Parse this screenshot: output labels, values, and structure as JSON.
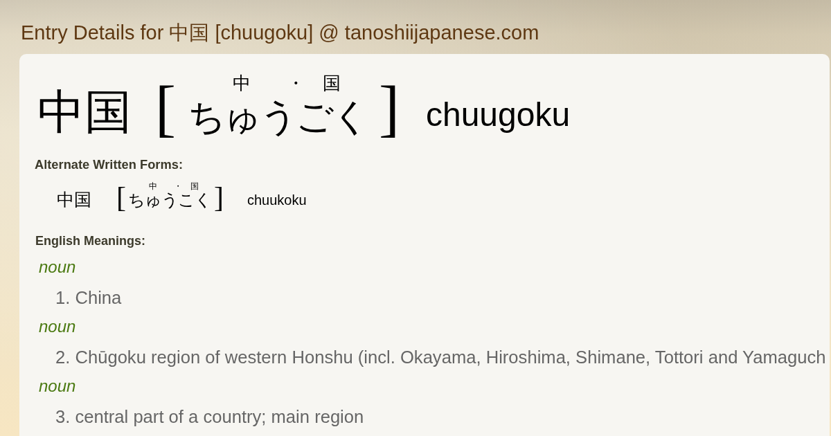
{
  "page_title": "Entry Details for 中国 [chuugoku] @ tanoshiijapanese.com",
  "entry": {
    "word": "中国",
    "reading": {
      "open": "[",
      "segments": [
        {
          "kanji": "中",
          "kana": "ちゅう"
        },
        {
          "kanji": "国",
          "kana": "ごく"
        }
      ],
      "separator": "・",
      "close": "]"
    },
    "romaji": "chuugoku"
  },
  "alternate_forms": {
    "heading": "Alternate Written Forms:",
    "forms": [
      {
        "word": "中国",
        "reading": {
          "open": "[",
          "segments": [
            {
              "kanji": "中",
              "kana": "ちゅう"
            },
            {
              "kanji": "国",
              "kana": "こく"
            }
          ],
          "separator": "・",
          "close": "]"
        },
        "romaji": "chuukoku"
      }
    ]
  },
  "meanings": {
    "heading": "English Meanings:",
    "senses": [
      {
        "pos": "noun",
        "text": "1. China"
      },
      {
        "pos": "noun",
        "text": "2. Chūgoku region of western Honshu (incl. Okayama, Hiroshima, Shimane, Tottori and Yamaguch"
      },
      {
        "pos": "noun",
        "text": "3. central part of a country; main region"
      }
    ]
  }
}
